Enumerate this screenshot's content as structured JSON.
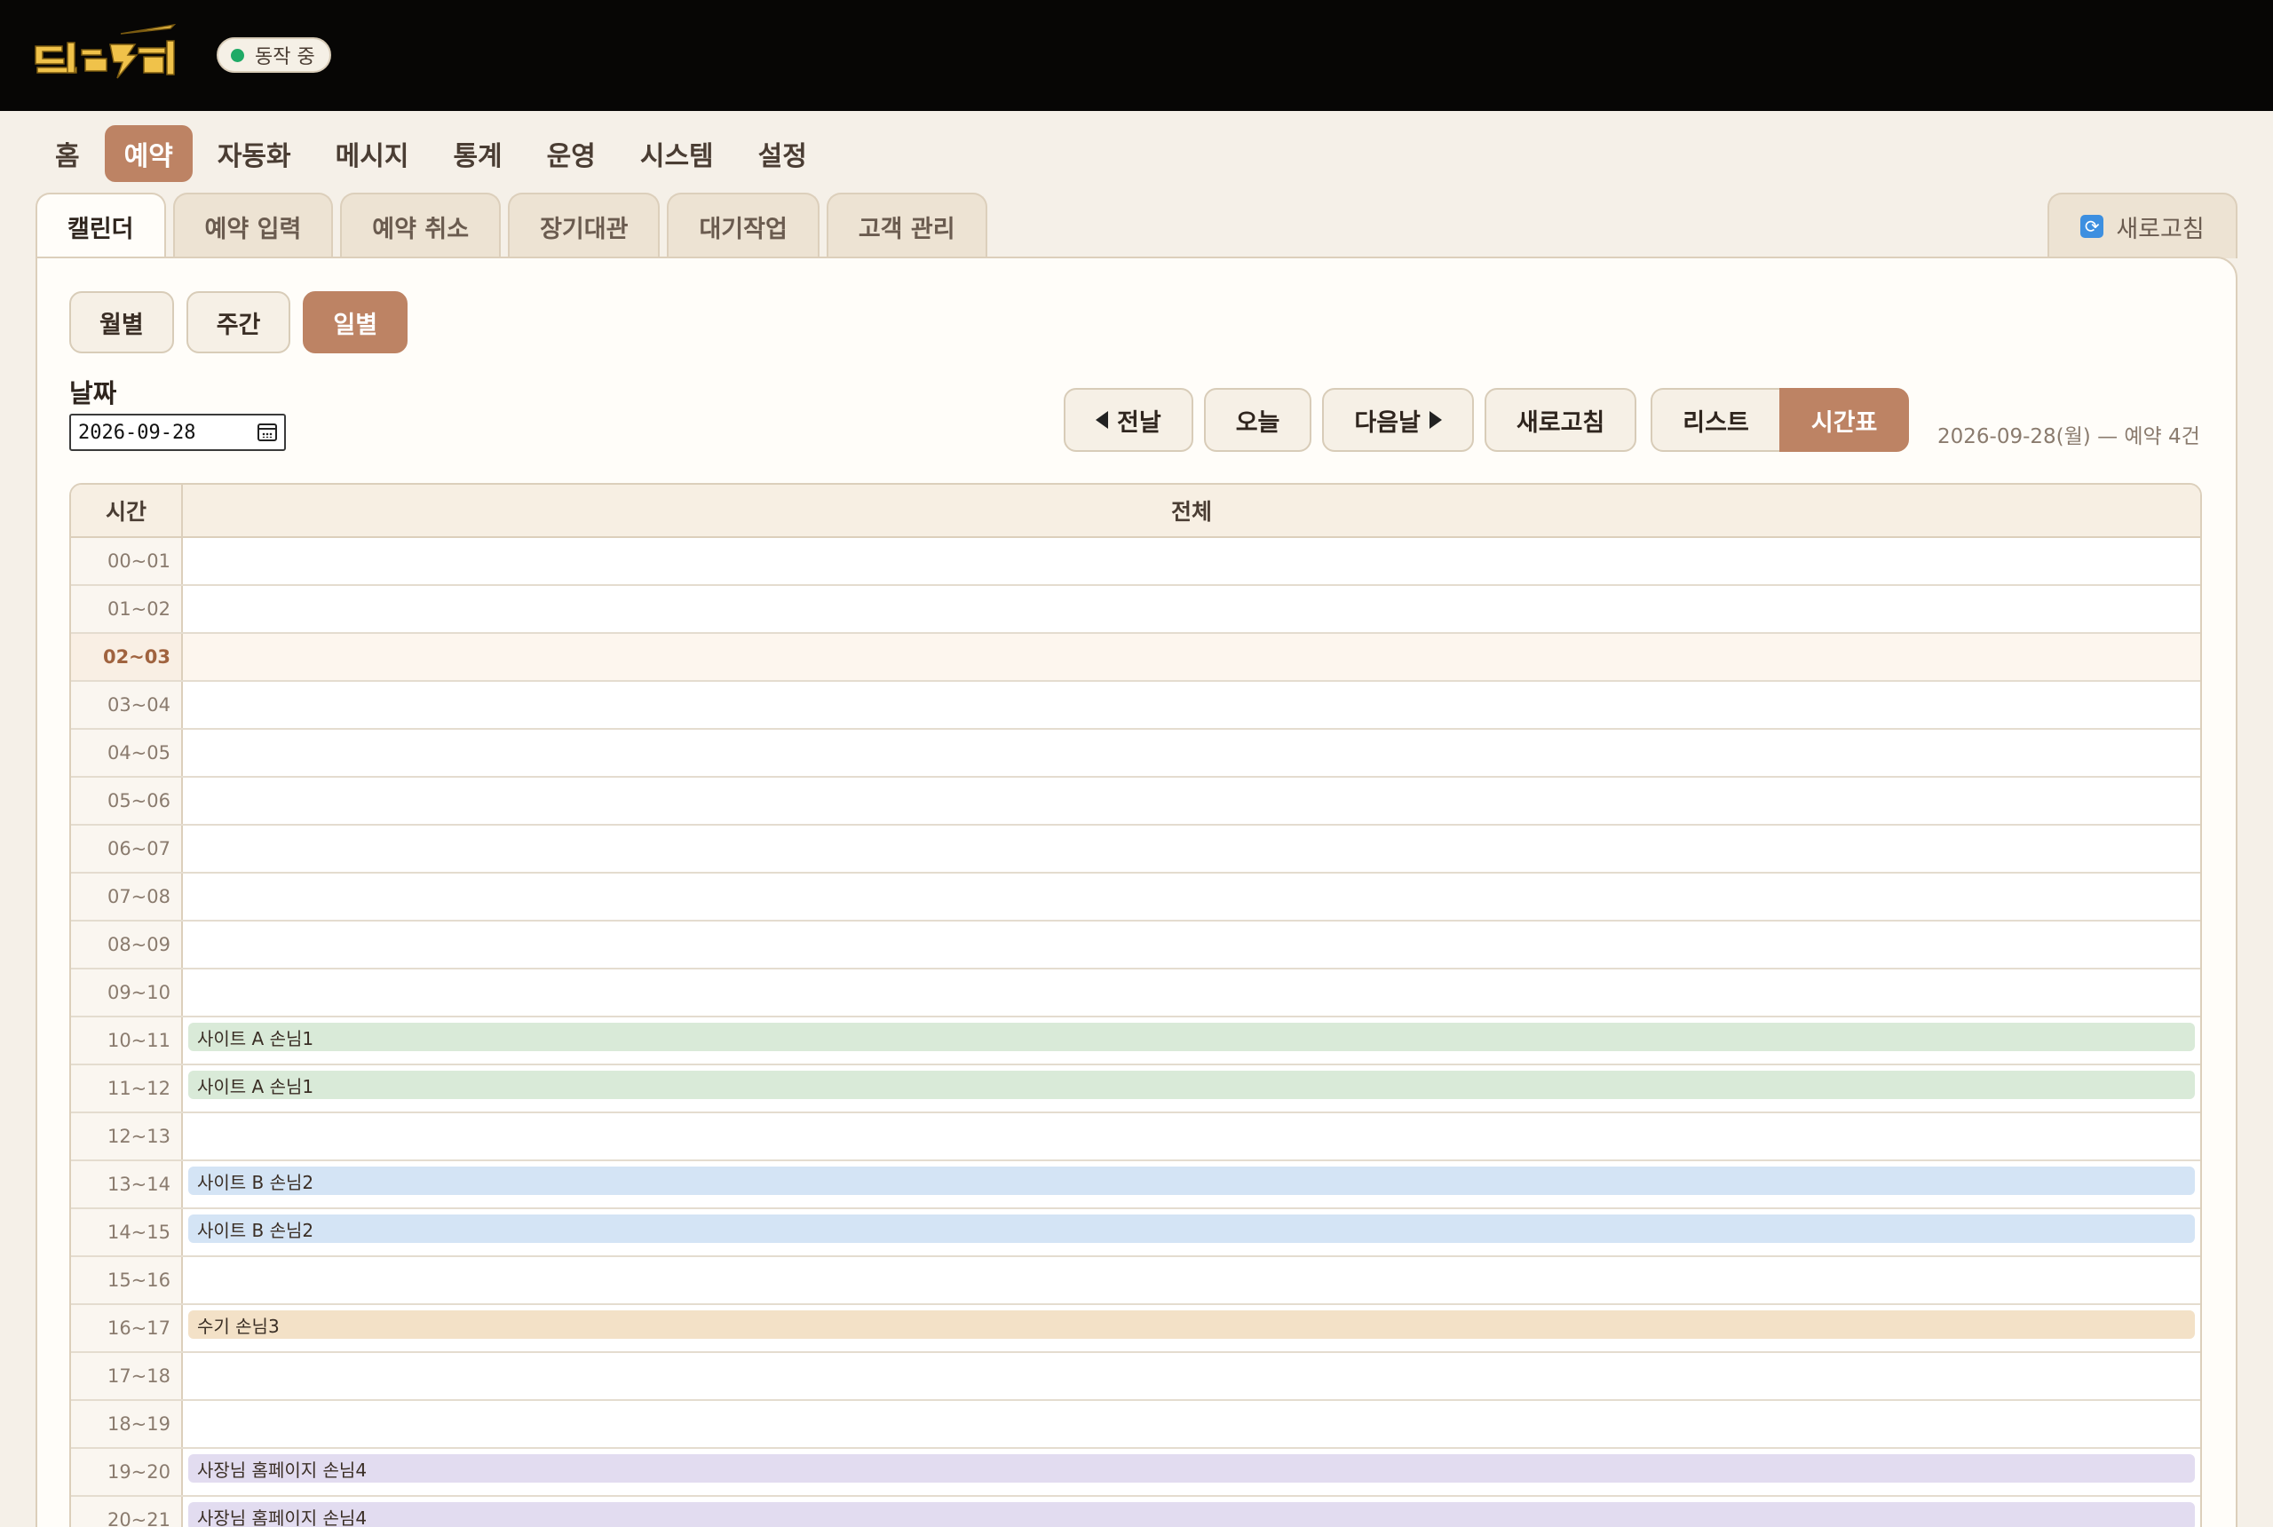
{
  "app": {
    "logo_text": "딸깍",
    "status_label": "동작 중",
    "status_color": "#1faa66",
    "accent_color": "#bd8364"
  },
  "main_nav": [
    {
      "label": "홈",
      "active": false
    },
    {
      "label": "예약",
      "active": true
    },
    {
      "label": "자동화",
      "active": false
    },
    {
      "label": "메시지",
      "active": false
    },
    {
      "label": "통계",
      "active": false
    },
    {
      "label": "운영",
      "active": false
    },
    {
      "label": "시스템",
      "active": false
    },
    {
      "label": "설정",
      "active": false
    }
  ],
  "sub_tabs": [
    {
      "label": "캘린더",
      "active": true
    },
    {
      "label": "예약 입력",
      "active": false
    },
    {
      "label": "예약 취소",
      "active": false
    },
    {
      "label": "장기대관",
      "active": false
    },
    {
      "label": "대기작업",
      "active": false
    },
    {
      "label": "고객 관리",
      "active": false
    }
  ],
  "refresh_tab": {
    "label": "새로고침",
    "icon": "refresh-icon"
  },
  "view_modes": [
    {
      "label": "월별",
      "active": false
    },
    {
      "label": "주간",
      "active": false
    },
    {
      "label": "일별",
      "active": true
    }
  ],
  "date_field": {
    "label": "날짜",
    "value": "2026-09-28"
  },
  "toolbar": {
    "prev_label": "전날",
    "today_label": "오늘",
    "next_label": "다음날",
    "refresh_label": "새로고침",
    "list_label": "리스트",
    "timetable_label": "시간표",
    "summary": "2026-09-28(월) — 예약 4건"
  },
  "timetable": {
    "header_time": "시간",
    "header_all": "전체",
    "rows": [
      {
        "time": "00~01",
        "booking": "",
        "color": ""
      },
      {
        "time": "01~02",
        "booking": "",
        "color": ""
      },
      {
        "time": "02~03",
        "booking": "",
        "color": "",
        "current": true
      },
      {
        "time": "03~04",
        "booking": "",
        "color": ""
      },
      {
        "time": "04~05",
        "booking": "",
        "color": ""
      },
      {
        "time": "05~06",
        "booking": "",
        "color": ""
      },
      {
        "time": "06~07",
        "booking": "",
        "color": ""
      },
      {
        "time": "07~08",
        "booking": "",
        "color": ""
      },
      {
        "time": "08~09",
        "booking": "",
        "color": ""
      },
      {
        "time": "09~10",
        "booking": "",
        "color": ""
      },
      {
        "time": "10~11",
        "booking": "사이트 A 손님1",
        "color": "green"
      },
      {
        "time": "11~12",
        "booking": "사이트 A 손님1",
        "color": "green"
      },
      {
        "time": "12~13",
        "booking": "",
        "color": ""
      },
      {
        "time": "13~14",
        "booking": "사이트 B 손님2",
        "color": "blue"
      },
      {
        "time": "14~15",
        "booking": "사이트 B 손님2",
        "color": "blue"
      },
      {
        "time": "15~16",
        "booking": "",
        "color": ""
      },
      {
        "time": "16~17",
        "booking": "수기 손님3",
        "color": "orange"
      },
      {
        "time": "17~18",
        "booking": "",
        "color": ""
      },
      {
        "time": "18~19",
        "booking": "",
        "color": ""
      },
      {
        "time": "19~20",
        "booking": "사장님 홈페이지 손님4",
        "color": "purple"
      },
      {
        "time": "20~21",
        "booking": "사장님 홈페이지 손님4",
        "color": "purple"
      }
    ]
  }
}
